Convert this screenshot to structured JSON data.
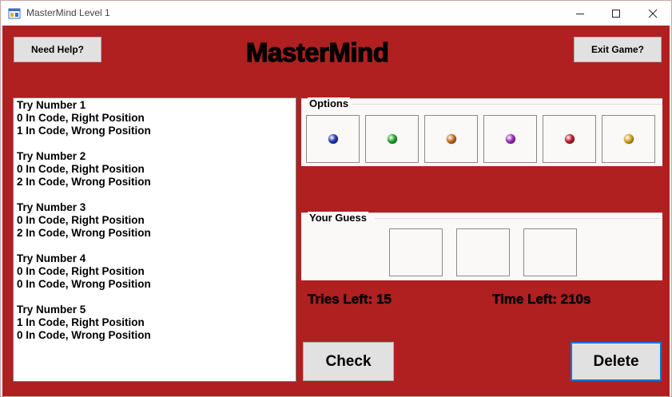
{
  "window": {
    "title": "MasterMind Level 1"
  },
  "header": {
    "help_label": "Need Help?",
    "app_title": "MasterMind",
    "exit_label": "Exit Game?"
  },
  "log": {
    "text": "Try Number 1\n0 In Code, Right Position\n1 In Code, Wrong Position\n\nTry Number 2\n0 In Code, Right Position\n2 In Code, Wrong Position\n\nTry Number 3\n0 In Code, Right Position\n2 In Code, Wrong Position\n\nTry Number 4\n0 In Code, Right Position\n0 In Code, Wrong Position\n\nTry Number 5\n1 In Code, Right Position\n0 In Code, Wrong Position"
  },
  "options": {
    "label": "Options",
    "colors": [
      "#1d37b4",
      "#1fa82a",
      "#c96a1a",
      "#9a2ac0",
      "#c0182a",
      "#d4a41a"
    ]
  },
  "guess": {
    "label": "Your Guess"
  },
  "status": {
    "tries": "Tries Left: 15",
    "time": "Time Left: 210s"
  },
  "actions": {
    "check_label": "Check",
    "delete_label": "Delete"
  },
  "theme": {
    "background": "#b02020"
  }
}
